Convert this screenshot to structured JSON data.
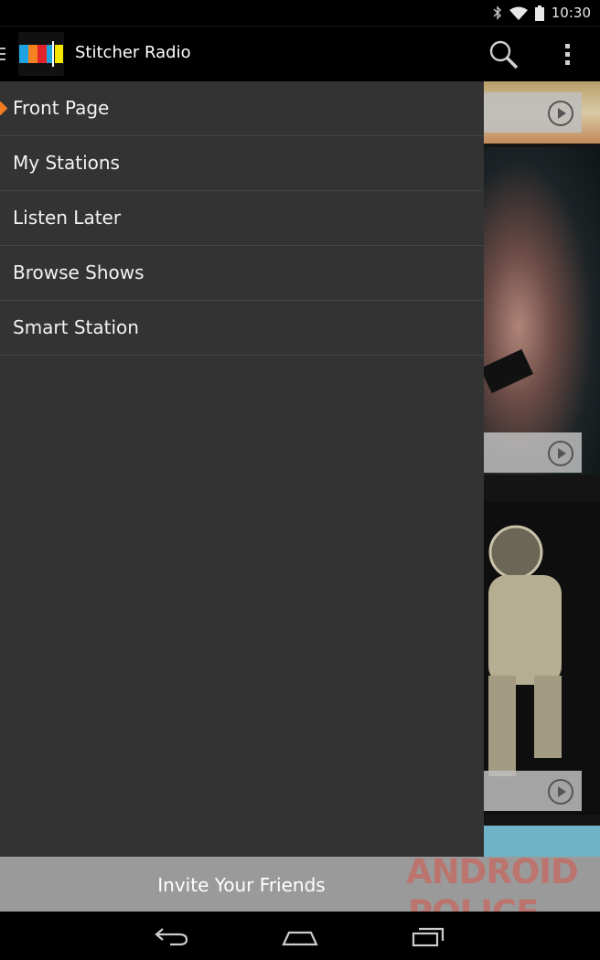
{
  "status_bar": {
    "time": "10:30",
    "icons": [
      "bluetooth-icon",
      "wifi-icon",
      "battery-icon"
    ]
  },
  "action_bar": {
    "title": "Stitcher Radio",
    "icons": [
      "drawer-indicator-icon",
      "app-logo-icon",
      "search-icon",
      "overflow-menu-icon"
    ]
  },
  "drawer": {
    "items": [
      {
        "label": "Front Page",
        "active": true
      },
      {
        "label": "My Stations",
        "active": false
      },
      {
        "label": "Listen Later",
        "active": false
      },
      {
        "label": "Browse Shows",
        "active": false
      },
      {
        "label": "Smart Station",
        "active": false
      }
    ]
  },
  "invite": {
    "label": "Invite Your Friends"
  },
  "watermark": {
    "line1": "ANDROID",
    "line2": "POLICE"
  },
  "nav_bar": {
    "icons": [
      "back-icon",
      "home-icon",
      "recents-icon"
    ]
  },
  "colors": {
    "accent": "#f47b20",
    "drawer_bg": "#333333",
    "invite_bg": "#9a9a9a"
  }
}
